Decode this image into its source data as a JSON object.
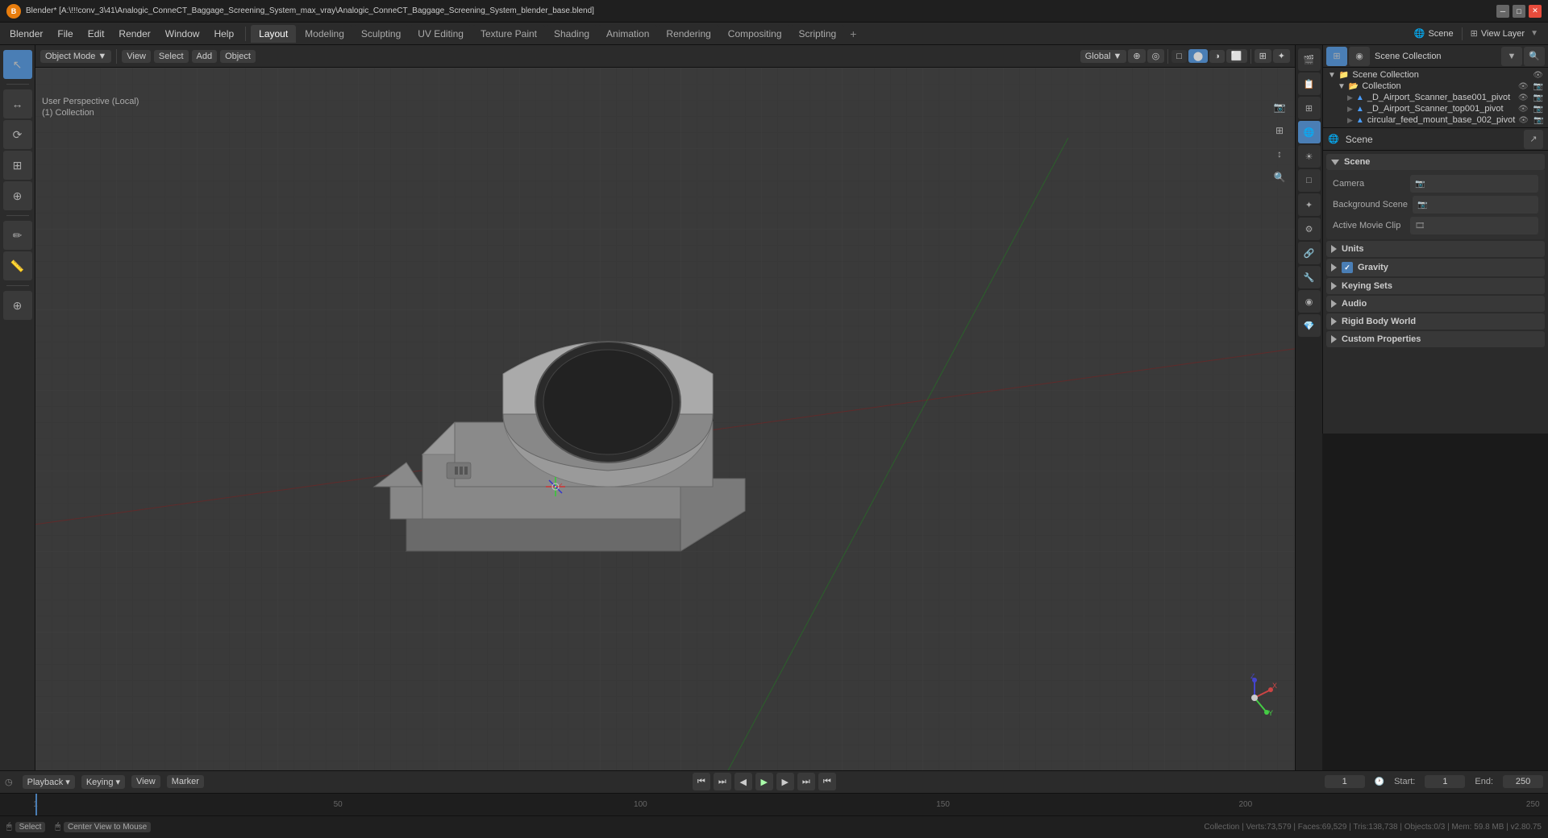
{
  "titlebar": {
    "title": "Blender* [A:\\!!!conv_3\\41\\Analogic_ConneCT_Baggage_Screening_System_max_vray\\Analogic_ConneCT_Baggage_Screening_System_blender_base.blend]",
    "min_label": "─",
    "max_label": "□",
    "close_label": "✕"
  },
  "menubar": {
    "items": [
      "Blender",
      "File",
      "Edit",
      "Render",
      "Window",
      "Help"
    ],
    "workspace_tabs": [
      "Layout",
      "Modeling",
      "Sculpting",
      "UV Editing",
      "Texture Paint",
      "Shading",
      "Animation",
      "Rendering",
      "Compositing",
      "Scripting"
    ],
    "active_tab": "Layout",
    "plus_label": "+",
    "scene_label": "Scene",
    "view_layer_label": "View Layer"
  },
  "viewport": {
    "mode_label": "Object Mode",
    "view_label": "View",
    "select_label": "Select",
    "add_label": "Add",
    "object_label": "Object",
    "viewport_shading": [
      "Wireframe",
      "Solid",
      "Material Preview",
      "Rendered"
    ],
    "active_shading": "Solid",
    "info_line1": "User Perspective (Local)",
    "info_line2": "(1) Collection",
    "global_label": "Global"
  },
  "outliner": {
    "title": "Scene Collection",
    "items": [
      {
        "name": "Collection",
        "indent": 1,
        "type": "collection",
        "expanded": true
      },
      {
        "name": "_D_Airport_Scanner_base001_pivot",
        "indent": 2,
        "type": "mesh"
      },
      {
        "name": "_D_Airport_Scanner_top001_pivot",
        "indent": 2,
        "type": "mesh"
      },
      {
        "name": "circular_feed_mount_base_002_pivot",
        "indent": 2,
        "type": "mesh"
      }
    ]
  },
  "properties": {
    "panel_title": "Scene",
    "scene_label": "Scene",
    "tabs": [
      "render",
      "output",
      "view",
      "scene",
      "world",
      "object",
      "particles",
      "physics",
      "constraints",
      "modifiers",
      "data",
      "material",
      "texture"
    ],
    "active_tab": "scene",
    "sections": [
      {
        "title": "Scene",
        "expanded": true,
        "rows": [
          {
            "label": "Camera",
            "value": ""
          },
          {
            "label": "Background Scene",
            "value": ""
          },
          {
            "label": "Active Movie Clip",
            "value": ""
          }
        ]
      },
      {
        "title": "Units",
        "expanded": false
      },
      {
        "title": "Gravity",
        "expanded": false,
        "has_checkbox": true,
        "checked": true
      },
      {
        "title": "Keying Sets",
        "expanded": false
      },
      {
        "title": "Audio",
        "expanded": false
      },
      {
        "title": "Rigid Body World",
        "expanded": false
      },
      {
        "title": "Custom Properties",
        "expanded": false
      }
    ]
  },
  "timeline": {
    "header_items": [
      "Playback",
      "Keying",
      "View",
      "Marker"
    ],
    "controls": [
      "⏮",
      "⏭",
      "◀◀",
      "▶",
      "▶▶",
      "⏯",
      "⏭"
    ],
    "current_frame": "1",
    "start_label": "Start:",
    "start_value": "1",
    "end_label": "End:",
    "end_value": "250",
    "numbers": [
      "1",
      "50",
      "100",
      "150",
      "200",
      "250"
    ],
    "number_positions": [
      "0",
      "16.6",
      "33.2",
      "49.8",
      "66.4",
      "83"
    ]
  },
  "statusbar": {
    "select_key": "Select",
    "center_view": "Center View to Mouse",
    "stats": "Collection | Verts:73,579 | Faces:69,529 | Tris:138,738 | Objects:0/3 | Mem: 59.8 MB | v2.80.75"
  },
  "icons": {
    "tools": [
      "↖",
      "↔",
      "↕",
      "⟳",
      "⊞",
      "✏",
      "✒",
      "⬛",
      "🔺",
      "⚙",
      "💡",
      "📏"
    ],
    "props_side": [
      "🎬",
      "📷",
      "📊",
      "🌐",
      "☀",
      "📦",
      "✦",
      "🔗",
      "🔧",
      "◉",
      "💎",
      "🎨"
    ],
    "camera_icon": "📷",
    "film_icon": "🎬",
    "movie_icon": "🎞"
  }
}
